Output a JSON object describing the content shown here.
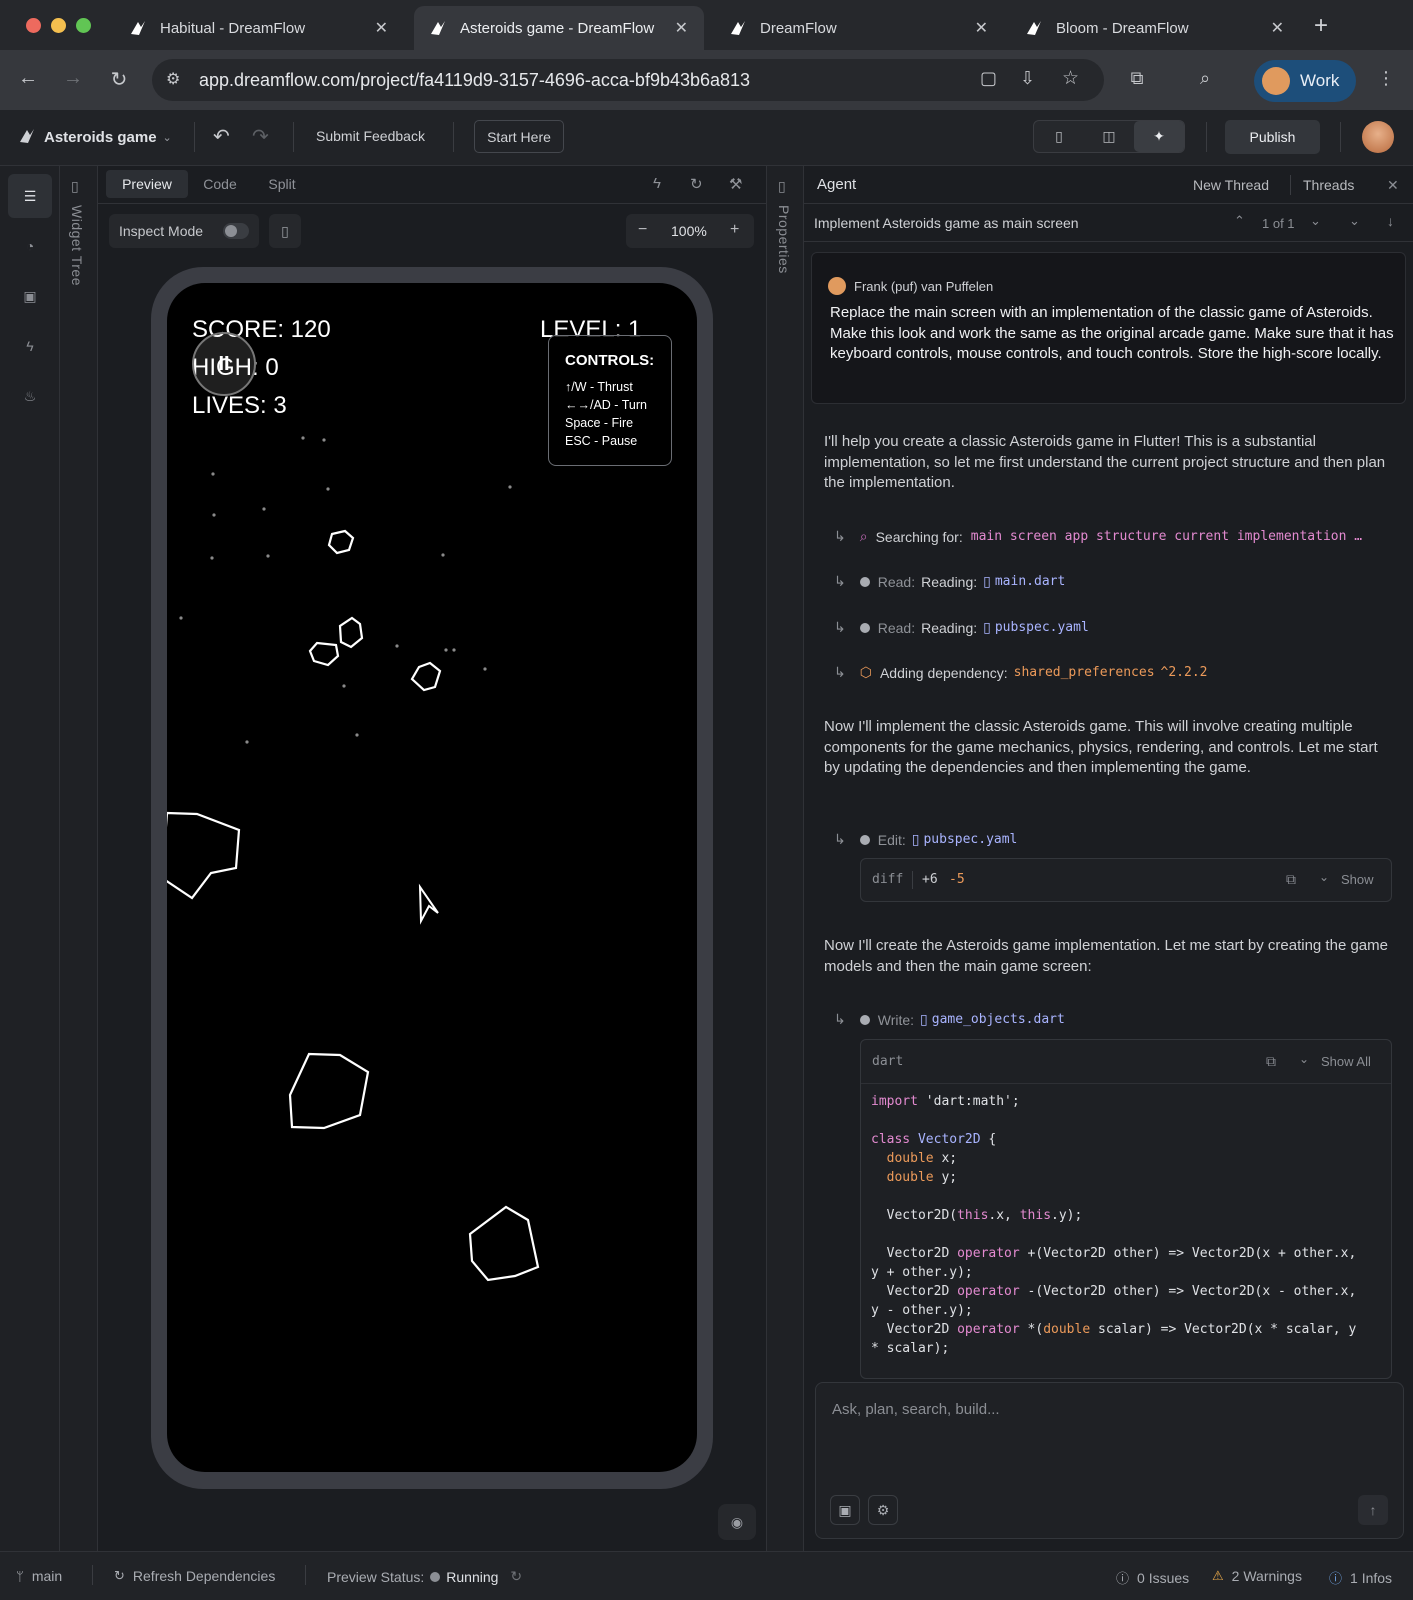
{
  "browser": {
    "tabs": [
      {
        "title": "Habitual - DreamFlow"
      },
      {
        "title": "Asteroids game - DreamFlow"
      },
      {
        "title": "DreamFlow"
      },
      {
        "title": "Bloom - DreamFlow"
      }
    ],
    "url": "app.dreamflow.com/project/fa4119d9-3157-4696-acca-bf9b43b6a813",
    "profile_label": "Work"
  },
  "app_header": {
    "project_name": "Asteroids game",
    "submit_feedback": "Submit Feedback",
    "start_here": "Start Here",
    "publish": "Publish"
  },
  "left_panel": {
    "widget_tree_label": "Widget Tree"
  },
  "preview": {
    "tabs": [
      "Preview",
      "Code",
      "Split"
    ],
    "inspect_mode_label": "Inspect Mode",
    "zoom": "100%"
  },
  "game": {
    "score": "SCORE: 120",
    "high": "HIGH: 0",
    "lives": "LIVES: 3",
    "level": "LEVEL: 1",
    "pause_symbol": "II",
    "controls": {
      "title": "CONTROLS:",
      "lines": [
        "↑/W - Thrust",
        "←→/AD - Turn",
        "Space - Fire",
        "ESC - Pause"
      ]
    }
  },
  "properties_label": "Properties",
  "agent": {
    "title": "Agent",
    "new_thread": "New Thread",
    "threads": "Threads",
    "thread_title": "Implement Asteroids game as main screen",
    "thread_counter": "1 of 1",
    "user": {
      "name": "Frank (puf) van Puffelen",
      "message": "Replace the main screen with an implementation of the classic game of Asteroids. Make this look and work the same as the original arcade game. Make sure that it has keyboard controls, mouse controls, and touch controls. Store the high-score locally."
    },
    "p1": "I'll help you create a classic Asteroids game in Flutter! This is a substantial implementation, so let me first understand the current project structure and then plan the implementation.",
    "steps": {
      "search_label": "Searching for:",
      "search_query": "main screen app structure current implementation …",
      "read1_kw": "Read:",
      "read1_label": "Reading:",
      "read1_file": "main.dart",
      "read2_kw": "Read:",
      "read2_label": "Reading:",
      "read2_file": "pubspec.yaml",
      "dep_label": "Adding dependency:",
      "dep_name": "shared_preferences",
      "dep_version": "^2.2.2"
    },
    "p2": "Now I'll implement the classic Asteroids game. This will involve creating multiple components for the game mechanics, physics, rendering, and controls. Let me start by updating the dependencies and then implementing the game.",
    "edit": {
      "kw": "Edit:",
      "file": "pubspec.yaml",
      "diff_label": "diff",
      "added": "+6",
      "removed": "-5",
      "show": "Show"
    },
    "p3": "Now I'll create the Asteroids game implementation. Let me start by creating the game models and then the main game screen:",
    "write": {
      "kw": "Write:",
      "file": "game_objects.dart",
      "lang": "dart",
      "show_all": "Show All"
    },
    "input_placeholder": "Ask, plan, search, build..."
  },
  "statusbar": {
    "branch": "main",
    "refresh": "Refresh Dependencies",
    "preview_status_label": "Preview Status:",
    "preview_status": "Running",
    "issues": "0 Issues",
    "warnings": "2 Warnings",
    "infos": "1 Infos"
  },
  "colors": {
    "accent_blue": "#1d4e7a",
    "code_keyword": "#e38ad0",
    "code_type": "#a9b4ff",
    "code_orange": "#ec9a5a",
    "warning": "#e8a84a"
  }
}
